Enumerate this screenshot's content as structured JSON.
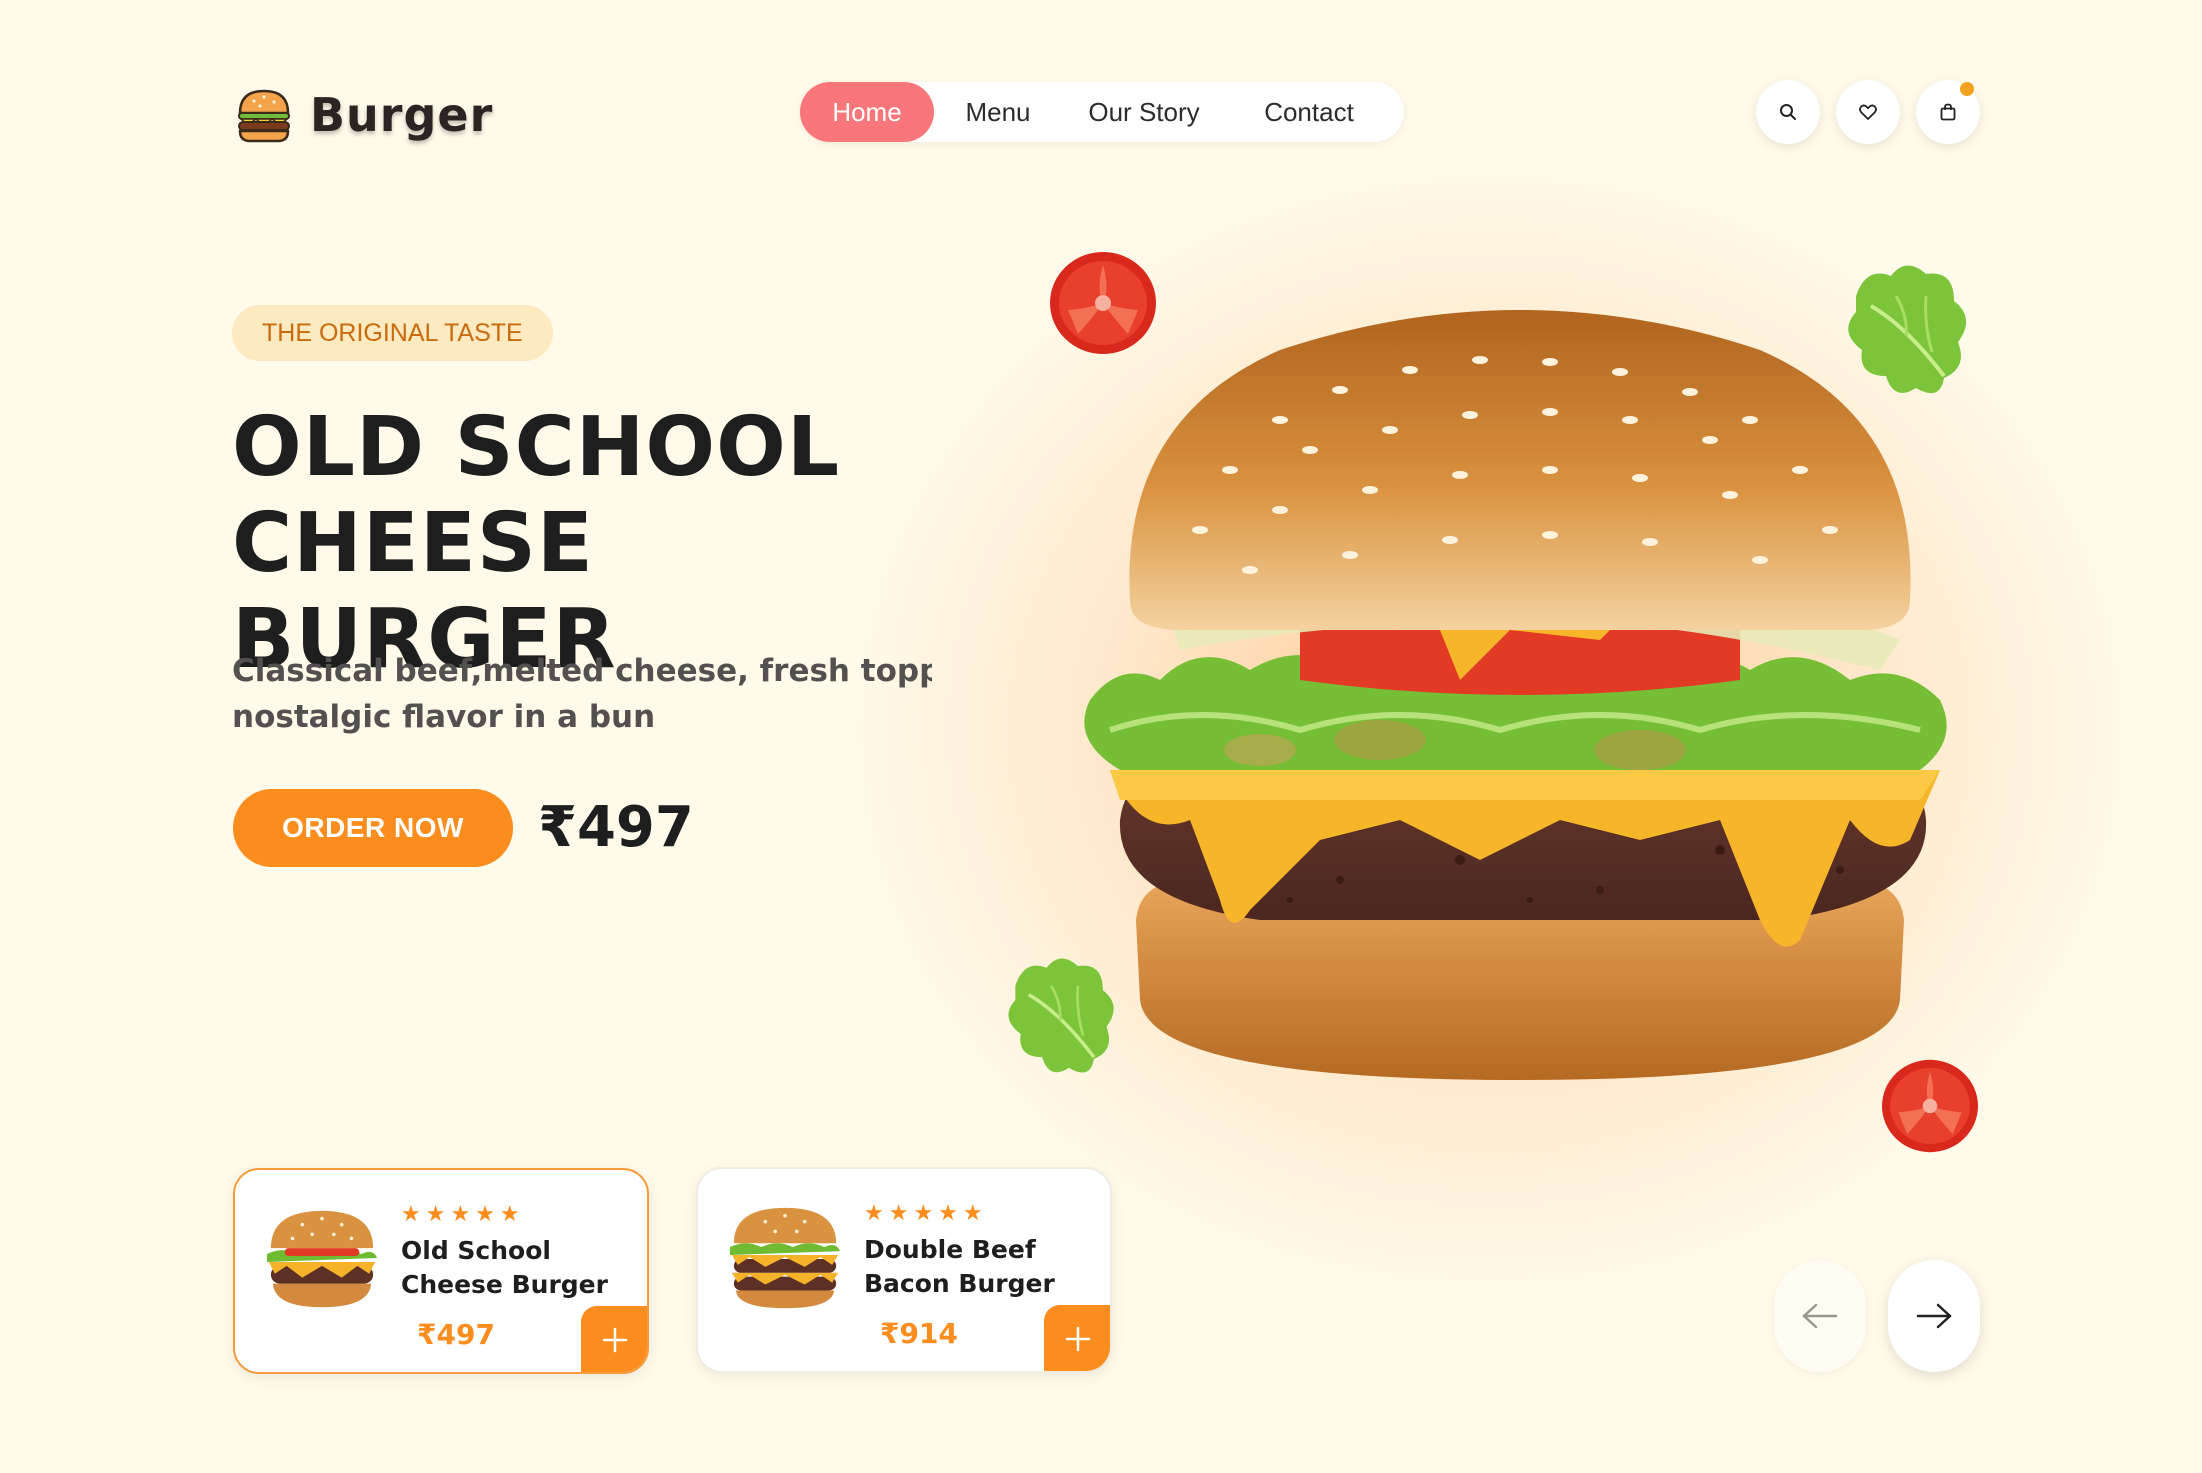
{
  "brand": {
    "name": "Burger",
    "logo_icon": "burger-icon"
  },
  "nav": {
    "items": [
      "Home",
      "Menu",
      "Our Story",
      "Contact"
    ],
    "active": "Home",
    "active_color": "#f9777a"
  },
  "header_actions": {
    "search_icon": "search-icon",
    "wishlist_icon": "heart-icon",
    "cart_icon": "shopping-bag-icon",
    "cart_badge_color": "#f3a21f"
  },
  "hero": {
    "tag": "THE ORIGINAL TASTE",
    "title_line1": "OLD SCHOOL",
    "title_line2": "CHEESE BURGER",
    "description_line1": "Classical beef,melted cheese, fresh toppings",
    "description_line2": "nostalgic flavor in a bun",
    "cta_label": "ORDER NOW",
    "price": "₹497",
    "image": "cheeseburger-photo"
  },
  "products": [
    {
      "name_line1": "Old School",
      "name_line2": "Cheese Burger",
      "price": "₹497",
      "rating": 5,
      "stars": "★★★★★",
      "selected": true
    },
    {
      "name_line1": "Double Beef",
      "name_line2": "Bacon Burger",
      "price": "₹914",
      "rating": 5,
      "stars": "★★★★★",
      "selected": false
    }
  ],
  "carousel": {
    "prev_icon": "arrow-left-icon",
    "next_icon": "arrow-right-icon"
  },
  "colors": {
    "background": "#fffaea",
    "accent": "#fb8c1e",
    "nav_active": "#f9777a",
    "tag_bg": "#fdeac0",
    "tag_text": "#c96b0c"
  }
}
